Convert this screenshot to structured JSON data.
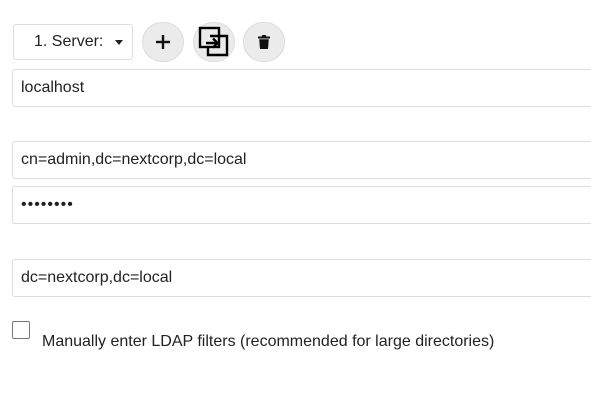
{
  "server_selector": {
    "selected": "1. Server:"
  },
  "buttons": {
    "add_icon": "plus-icon",
    "copy_icon": "copy-icon",
    "delete_icon": "trash-icon"
  },
  "fields": {
    "host": "localhost",
    "bind_dn": "cn=admin,dc=nextcorp,dc=local",
    "password": "••••••••",
    "base_dn": "dc=nextcorp,dc=local"
  },
  "manual_filters": {
    "checked": false,
    "label": "Manually enter LDAP filters (recommended for large directories)"
  }
}
